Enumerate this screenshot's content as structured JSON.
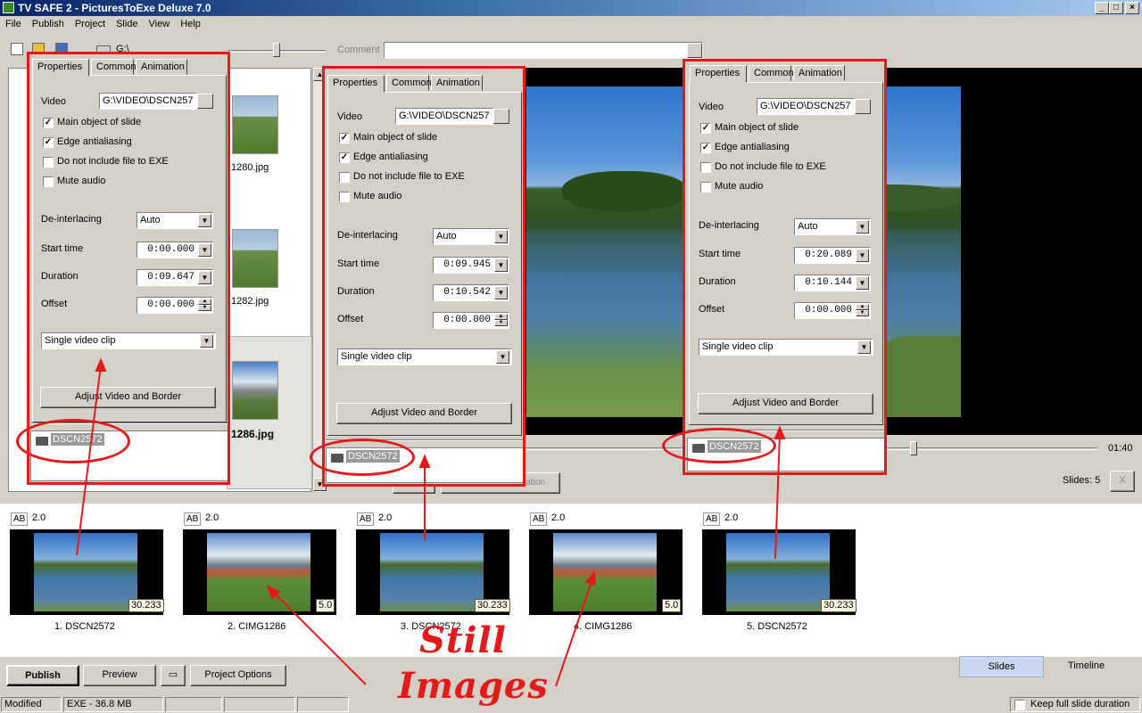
{
  "window": {
    "title": "TV SAFE 2 - PicturesToExe Deluxe 7.0",
    "min": "_",
    "max": "□",
    "close": "×"
  },
  "menu": [
    "File",
    "Publish",
    "Project",
    "Slide",
    "View",
    "Help"
  ],
  "toolbar": {
    "drive": "G:\\",
    "comment_label": "Comment"
  },
  "filelist": {
    "items": [
      "1280.jpg",
      "1282.jpg",
      "1286.jpg"
    ]
  },
  "preview": {
    "time": "01:40",
    "slides_count": "Slides: 5",
    "close_x": "X",
    "btn_customize": "Customize Slide",
    "btn_objects": "Objects and Animation"
  },
  "panels": [
    {
      "tabs": [
        "Properties",
        "Common",
        "Animation"
      ],
      "video_label": "Video",
      "video_path": "G:\\VIDEO\\DSCN257",
      "checks": [
        {
          "label": "Main object of slide",
          "checked": true
        },
        {
          "label": "Edge antialiasing",
          "checked": true
        },
        {
          "label": "Do not include file to EXE",
          "checked": false
        },
        {
          "label": "Mute audio",
          "checked": false
        }
      ],
      "deint_label": "De-interlacing",
      "deint": "Auto",
      "start_label": "Start time",
      "start": "0:00.000",
      "dur_label": "Duration",
      "dur": "0:09.647",
      "offset_label": "Offset",
      "offset": "0:00.000",
      "mode": "Single video clip",
      "adjust": "Adjust Video and Border",
      "object": "DSCN2572"
    },
    {
      "tabs": [
        "Properties",
        "Common",
        "Animation"
      ],
      "video_label": "Video",
      "video_path": "G:\\VIDEO\\DSCN257",
      "checks": [
        {
          "label": "Main object of slide",
          "checked": true
        },
        {
          "label": "Edge antialiasing",
          "checked": true
        },
        {
          "label": "Do not include file to EXE",
          "checked": false
        },
        {
          "label": "Mute audio",
          "checked": false
        }
      ],
      "deint_label": "De-interlacing",
      "deint": "Auto",
      "start_label": "Start time",
      "start": "0:09.945",
      "dur_label": "Duration",
      "dur": "0:10.542",
      "offset_label": "Offset",
      "offset": "0:00.000",
      "mode": "Single video clip",
      "adjust": "Adjust Video and Border",
      "object": "DSCN2572"
    },
    {
      "tabs": [
        "Properties",
        "Common",
        "Animation"
      ],
      "video_label": "Video",
      "video_path": "G:\\VIDEO\\DSCN257",
      "checks": [
        {
          "label": "Main object of slide",
          "checked": true
        },
        {
          "label": "Edge antialiasing",
          "checked": true
        },
        {
          "label": "Do not include file to EXE",
          "checked": false
        },
        {
          "label": "Mute audio",
          "checked": false
        }
      ],
      "deint_label": "De-interlacing",
      "deint": "Auto",
      "start_label": "Start time",
      "start": "0:20.089",
      "dur_label": "Duration",
      "dur": "0:10.144",
      "offset_label": "Offset",
      "offset": "0:00.000",
      "mode": "Single video clip",
      "adjust": "Adjust Video and Border",
      "object": "DSCN2572"
    }
  ],
  "slides": [
    {
      "ab": "AB",
      "trans": "2.0",
      "dur": "30.233",
      "name": "1. DSCN2572"
    },
    {
      "ab": "AB",
      "trans": "2.0",
      "dur": "5.0",
      "name": "2. CIMG1286"
    },
    {
      "ab": "AB",
      "trans": "2.0",
      "dur": "30.233",
      "name": "3. DSCN2572"
    },
    {
      "ab": "AB",
      "trans": "2.0",
      "dur": "5.0",
      "name": "4. CIMG1286"
    },
    {
      "ab": "AB",
      "trans": "2.0",
      "dur": "30.233",
      "name": "5. DSCN2572"
    }
  ],
  "bottom": {
    "publish": "Publish",
    "preview": "Preview",
    "project_options": "Project Options",
    "tab_slides": "Slides",
    "tab_timeline": "Timeline"
  },
  "status": {
    "state": "Modified",
    "exe": "EXE - 36.8 MB",
    "keep": "Keep full slide duration"
  },
  "annotation": {
    "line1": "Still",
    "line2": "Images"
  },
  "colors": {
    "annotation_red": "#e21a1a",
    "title_blue": "#0a246a"
  }
}
